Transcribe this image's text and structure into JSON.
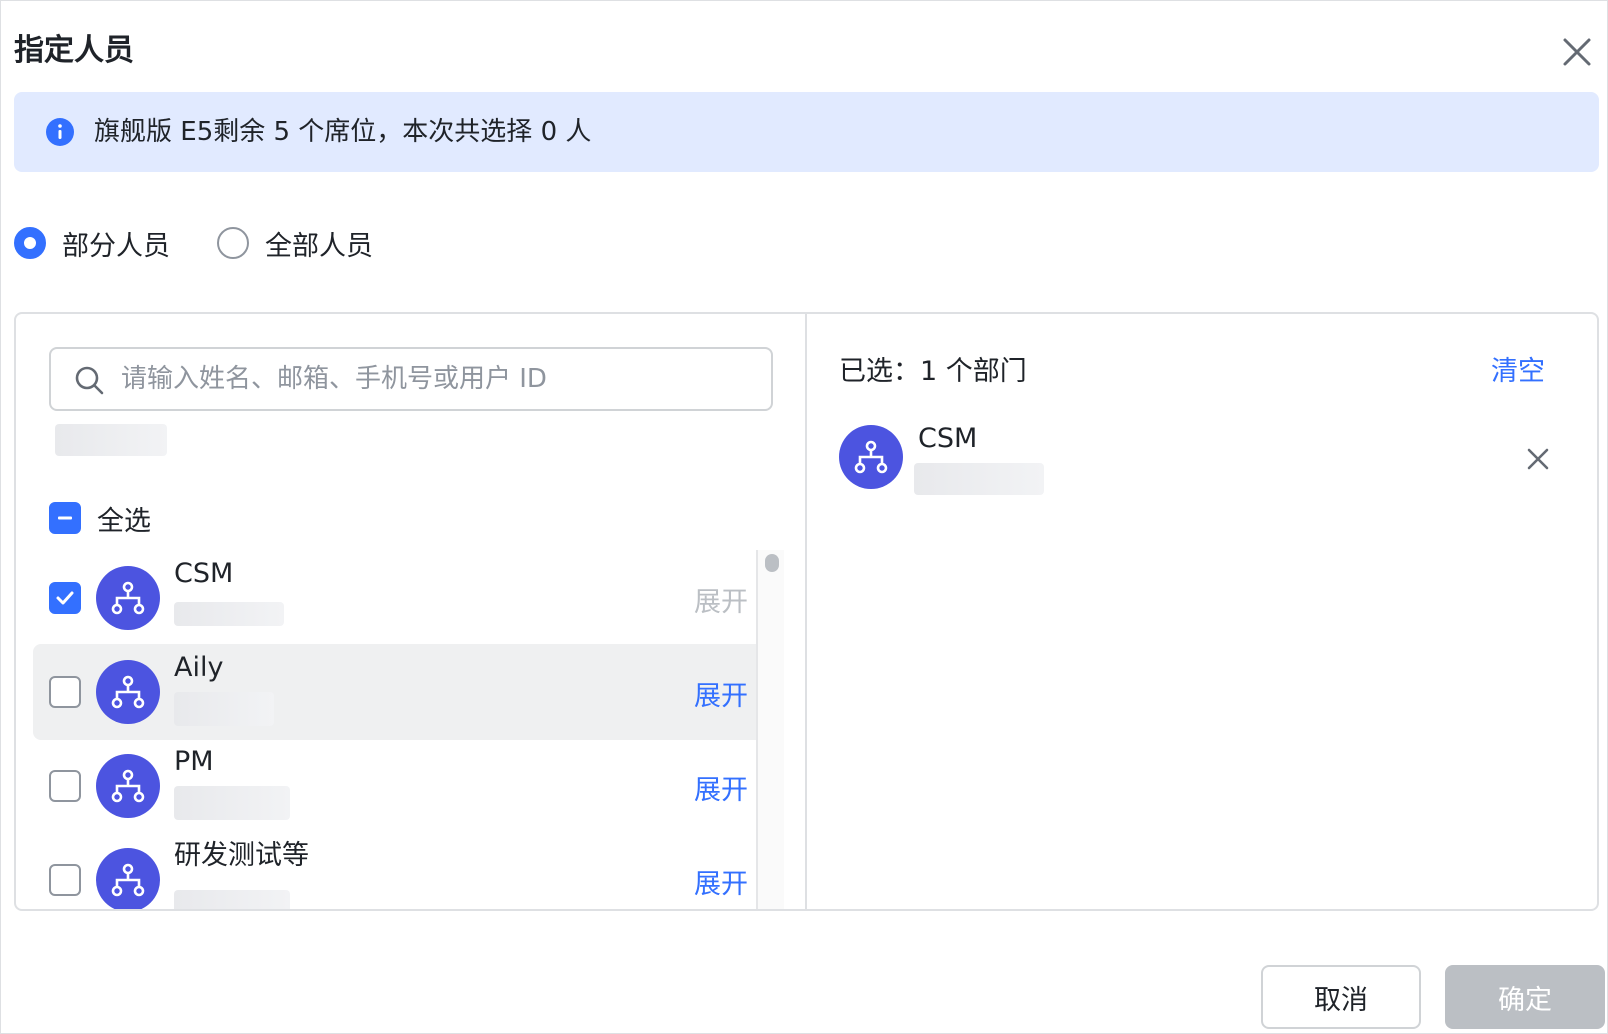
{
  "dialog": {
    "title": "指定人员",
    "close_icon": "close-icon"
  },
  "banner": {
    "icon": "info-icon",
    "text": "旗舰版 E5剩余 5 个席位，本次共选择 0 人"
  },
  "scope": {
    "options": [
      {
        "label": "部分人员",
        "checked": true
      },
      {
        "label": "全部人员",
        "checked": false
      }
    ]
  },
  "left": {
    "search_placeholder": "请输入姓名、邮箱、手机号或用户 ID",
    "select_all_label": "全选",
    "items": [
      {
        "name": "CSM",
        "checked": true,
        "expand": "展开",
        "expand_disabled": true
      },
      {
        "name": "Aily",
        "checked": false,
        "expand": "展开",
        "expand_disabled": false
      },
      {
        "name": "PM",
        "checked": false,
        "expand": "展开",
        "expand_disabled": false
      },
      {
        "name": "研发测试等",
        "checked": false,
        "expand": "展开",
        "expand_disabled": false
      }
    ]
  },
  "right": {
    "selected_summary": "已选：1 个部门",
    "clear_label": "清空",
    "selected": [
      {
        "name": "CSM"
      }
    ]
  },
  "footer": {
    "cancel_label": "取消",
    "confirm_label": "确定"
  },
  "colors": {
    "accent": "#3370ff",
    "avatar": "#4c54e0",
    "banner_bg": "#e1eaff",
    "disabled": "#bbbfc4"
  }
}
